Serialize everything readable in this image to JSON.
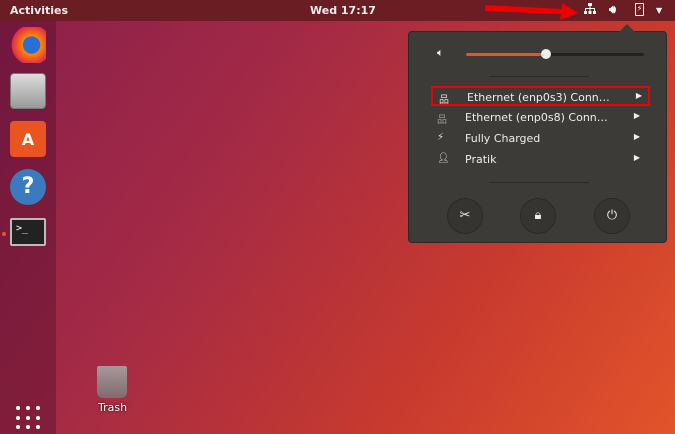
{
  "topbar": {
    "activities": "Activities",
    "clock": "Wed 17:17",
    "tray": [
      "network-icon",
      "volume-icon",
      "battery-icon",
      "menu-arrow-icon"
    ]
  },
  "dock": {
    "items": [
      "Firefox",
      "Files",
      "Ubuntu Software",
      "Help",
      "Terminal"
    ],
    "show_apps": "show-applications"
  },
  "desktop": {
    "trash_label": "Trash"
  },
  "menu": {
    "volume_percent": 50,
    "items": [
      {
        "label": "Ethernet (enp0s3) Conn…",
        "icon": "network-wired-icon"
      },
      {
        "label": "Ethernet (enp0s8) Conn…",
        "icon": "network-wired-disconnected-icon"
      },
      {
        "label": "Fully Charged",
        "icon": "battery-icon"
      },
      {
        "label": "Pratik",
        "icon": "user-icon"
      }
    ],
    "buttons": [
      "settings",
      "lock",
      "power-off"
    ]
  },
  "annotation_color": "#e00000"
}
